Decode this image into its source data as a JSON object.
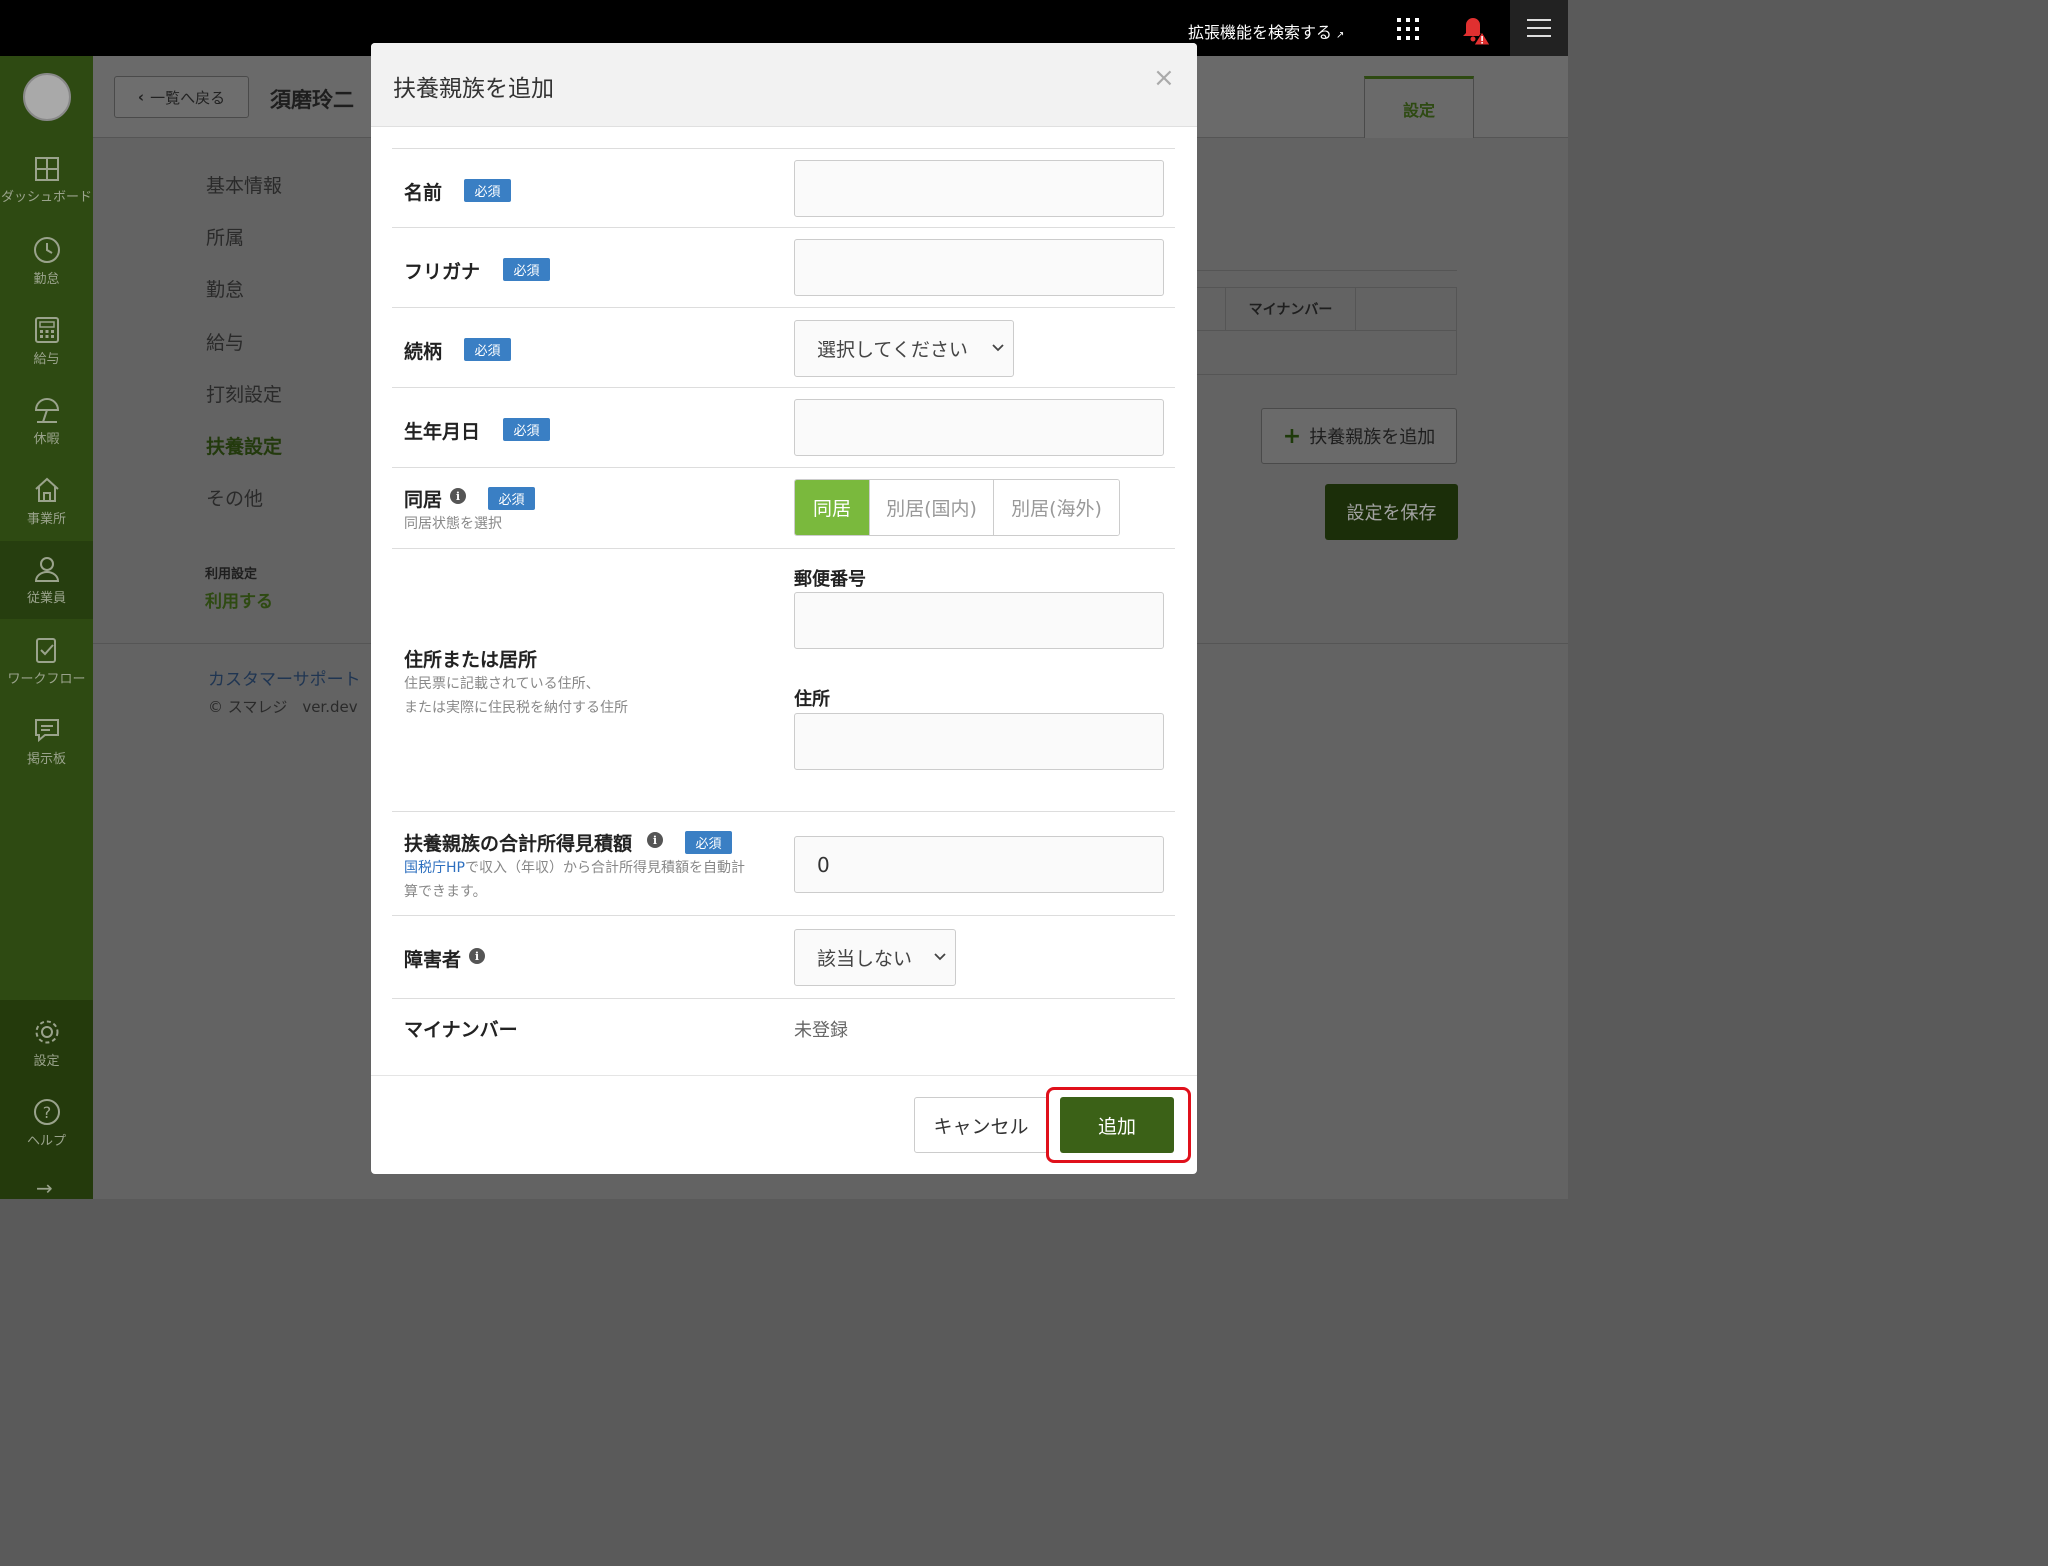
{
  "topbar": {
    "extension_search": "拡張機能を検索する",
    "external_mark": "↗"
  },
  "sidebar": {
    "items": [
      {
        "label": "ダッシュボード",
        "icon": "dashboard-icon"
      },
      {
        "label": "勤怠",
        "icon": "clock-icon"
      },
      {
        "label": "給与",
        "icon": "calculator-icon"
      },
      {
        "label": "休暇",
        "icon": "parasol-icon"
      },
      {
        "label": "事業所",
        "icon": "home-icon"
      },
      {
        "label": "従業員",
        "icon": "person-icon"
      },
      {
        "label": "ワークフロー",
        "icon": "clipboard-icon"
      },
      {
        "label": "掲示板",
        "icon": "chat-icon"
      }
    ],
    "bottom_items": [
      {
        "label": "設定",
        "icon": "gear-icon"
      },
      {
        "label": "ヘルプ",
        "icon": "help-icon"
      }
    ],
    "expand_arrow": "→"
  },
  "page": {
    "back_label": "一覧へ戻る",
    "employee_name": "須磨玲二",
    "tab_settings": "設定",
    "submenu": [
      "基本情報",
      "所属",
      "勤怠",
      "給与",
      "打刻設定",
      "扶養設定",
      "その他"
    ],
    "use_setting_label": "利用設定",
    "use_setting_value": "利用する",
    "support_link": "カスタマーサポート",
    "copyright": "© スマレジ　ver.dev",
    "table_col_mynumber": "マイナンバー",
    "add_dependent_button": "扶養親族を追加",
    "save_button": "設定を保存"
  },
  "modal": {
    "title": "扶養親族を追加",
    "close": "×",
    "required_badge": "必須",
    "fields": {
      "name": {
        "label": "名前",
        "value": ""
      },
      "furigana": {
        "label": "フリガナ",
        "value": ""
      },
      "relation": {
        "label": "続柄",
        "selected": "選択してください"
      },
      "birthdate": {
        "label": "生年月日",
        "value": ""
      },
      "cohabit": {
        "label": "同居",
        "note": "同居状態を選択",
        "options": [
          "同居",
          "別居(国内)",
          "別居(海外)"
        ],
        "selected": "同居"
      },
      "address": {
        "label": "住所または居所",
        "note_line1": "住民票に記載されている住所、",
        "note_line2": "または実際に住民税を納付する住所",
        "postal_label": "郵便番号",
        "postal_value": "",
        "address_label": "住所",
        "address_value": ""
      },
      "income": {
        "label": "扶養親族の合計所得見積額",
        "note_link": "国税庁HP",
        "note_text1": "で収入（年収）から合計所得見積額を自動計",
        "note_text2": "算できます。",
        "value": "0"
      },
      "disability": {
        "label": "障害者",
        "selected": "該当しない"
      },
      "mynumber": {
        "label": "マイナンバー",
        "value": "未登録"
      }
    },
    "cancel_button": "キャンセル",
    "add_button": "追加"
  },
  "colors": {
    "sidebar_bg": "#2e4a12",
    "accent_green": "#7ab93d",
    "primary_button": "#3b6117",
    "required_badge": "#3a7fc4",
    "highlight_border": "#e0101b"
  }
}
